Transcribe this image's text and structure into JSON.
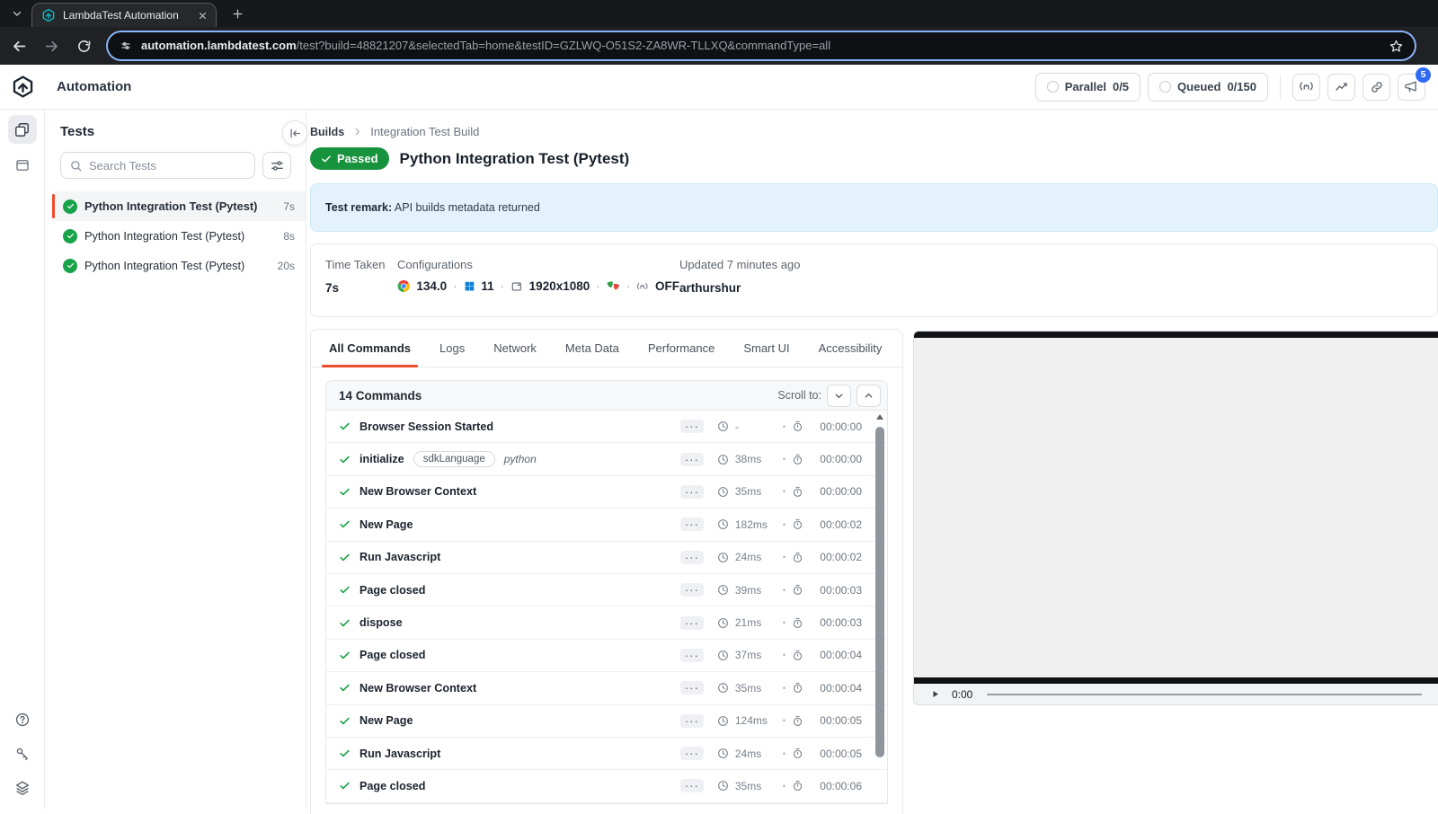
{
  "glyphs": {
    "dot": "·",
    "bullet": "•",
    "ellipsis": "···"
  },
  "browser": {
    "tab_title": "LambdaTest Automation",
    "url_domain": "automation.lambdatest.com",
    "url_path": "/test?build=48821207&selectedTab=home&testID=GZLWQ-O51S2-ZA8WR-TLLXQ&commandType=all"
  },
  "header": {
    "app_title": "Automation",
    "parallel_label": "Parallel",
    "parallel_value": "0/5",
    "queued_label": "Queued",
    "queued_value": "0/150",
    "notification_count": "5"
  },
  "sidebar": {
    "title": "Tests",
    "search_placeholder": "Search Tests",
    "tests": [
      {
        "name": "Python Integration Test (Pytest)",
        "duration": "7s"
      },
      {
        "name": "Python Integration Test (Pytest)",
        "duration": "8s"
      },
      {
        "name": "Python Integration Test (Pytest)",
        "duration": "20s"
      }
    ]
  },
  "main": {
    "breadcrumb": [
      "Builds",
      "Integration Test Build"
    ],
    "status": "Passed",
    "title": "Python Integration Test (Pytest)",
    "remark_label": "Test remark:",
    "remark_text": " API builds metadata returned",
    "info": {
      "time_taken_label": "Time Taken",
      "time_taken": "7s",
      "config_label": "Configurations",
      "browser_version": "134.0",
      "os_version": "11",
      "resolution": "1920x1080",
      "sensor_state": "OFF",
      "updated_label": "Updated 7 minutes ago",
      "user": "arthurshur"
    },
    "tabs": [
      "All Commands",
      "Logs",
      "Network",
      "Meta Data",
      "Performance",
      "Smart UI",
      "Accessibility"
    ],
    "commands_count": "14 Commands",
    "scroll_to_label": "Scroll to:",
    "commands": [
      {
        "name": "Browser Session Started",
        "duration": "-",
        "timestamp": "00:00:00"
      },
      {
        "name": "initialize",
        "tag": "sdkLanguage",
        "tag_value": "python",
        "duration": "38ms",
        "timestamp": "00:00:00"
      },
      {
        "name": "New Browser Context",
        "duration": "35ms",
        "timestamp": "00:00:00"
      },
      {
        "name": "New Page",
        "duration": "182ms",
        "timestamp": "00:00:02"
      },
      {
        "name": "Run Javascript",
        "duration": "24ms",
        "timestamp": "00:00:02"
      },
      {
        "name": "Page closed",
        "duration": "39ms",
        "timestamp": "00:00:03"
      },
      {
        "name": "dispose",
        "duration": "21ms",
        "timestamp": "00:00:03"
      },
      {
        "name": "Page closed",
        "duration": "37ms",
        "timestamp": "00:00:04"
      },
      {
        "name": "New Browser Context",
        "duration": "35ms",
        "timestamp": "00:00:04"
      },
      {
        "name": "New Page",
        "duration": "124ms",
        "timestamp": "00:00:05"
      },
      {
        "name": "Run Javascript",
        "duration": "24ms",
        "timestamp": "00:00:05"
      },
      {
        "name": "Page closed",
        "duration": "35ms",
        "timestamp": "00:00:06"
      }
    ]
  },
  "video": {
    "current_time": "0:00"
  }
}
